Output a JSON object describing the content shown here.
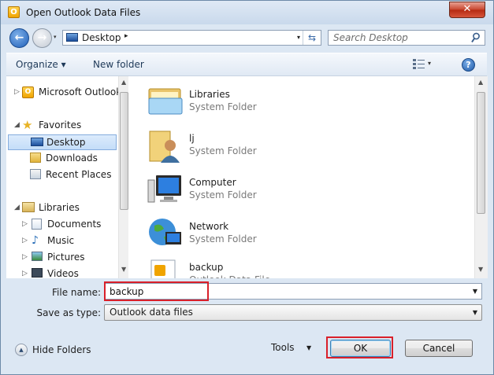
{
  "window": {
    "title": "Open Outlook Data Files",
    "close_glyph": "✕"
  },
  "address_bar": {
    "location": "Desktop",
    "separator": "▸",
    "dropdown": "▾",
    "refresh_glyph": "⇆"
  },
  "search": {
    "placeholder": "Search Desktop"
  },
  "toolbar": {
    "organize_label": "Organize ▾",
    "new_folder_label": "New folder",
    "views_dropdown": "▾",
    "help_label": "?"
  },
  "nav_pane": {
    "items": [
      {
        "label": "Microsoft Outlook",
        "icon": "outlook-icon",
        "expander": "▷"
      },
      {
        "label": "Favorites",
        "icon": "star-icon",
        "expander": "◢"
      },
      {
        "label": "Desktop",
        "icon": "desktop-icon",
        "selected": true
      },
      {
        "label": "Downloads",
        "icon": "downloads-icon"
      },
      {
        "label": "Recent Places",
        "icon": "recent-places-icon"
      },
      {
        "label": "Libraries",
        "icon": "libraries-icon",
        "expander": "◢"
      },
      {
        "label": "Documents",
        "icon": "documents-icon",
        "expander": "▷"
      },
      {
        "label": "Music",
        "icon": "music-icon",
        "expander": "▷"
      },
      {
        "label": "Pictures",
        "icon": "pictures-icon",
        "expander": "▷"
      },
      {
        "label": "Videos",
        "icon": "videos-icon",
        "expander": "▷"
      }
    ],
    "scroll_up": "▲",
    "scroll_down": "▼"
  },
  "files": [
    {
      "name": "Libraries",
      "type": "System Folder",
      "icon": "libraries-folder-icon"
    },
    {
      "name": "lj",
      "type": "System Folder",
      "icon": "user-folder-icon"
    },
    {
      "name": "Computer",
      "type": "System Folder",
      "icon": "computer-icon"
    },
    {
      "name": "Network",
      "type": "System Folder",
      "icon": "network-icon"
    },
    {
      "name": "backup",
      "type": "Outlook Data File",
      "icon": "outlook-data-file-icon"
    }
  ],
  "file_name": {
    "label": "File name:",
    "value": "backup",
    "dropdown": "▼"
  },
  "save_as_type": {
    "label": "Save as type:",
    "value": "Outlook data files",
    "dropdown": "▼"
  },
  "footer": {
    "hide_folders_label": "Hide Folders",
    "hide_folders_glyph": "▲",
    "tools_label": "Tools",
    "tools_dropdown": "▼",
    "ok_label": "OK",
    "cancel_label": "Cancel"
  },
  "colors": {
    "highlight": "#d9202a",
    "window_frame": "#dce7f3",
    "selection": "#c4ddf8"
  }
}
